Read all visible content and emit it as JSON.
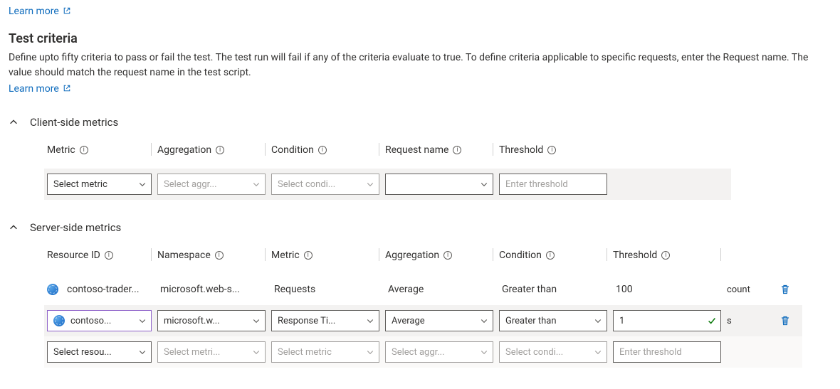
{
  "top_link": "Learn more",
  "section": {
    "title": "Test criteria",
    "description": "Define upto fifty criteria to pass or fail the test. The test run will fail if any of the criteria evaluate to true. To define criteria applicable to specific requests, enter the Request name. The value should match the request name in the test script.",
    "learn_more": "Learn more"
  },
  "client": {
    "title": "Client-side metrics",
    "headers": {
      "metric": "Metric",
      "aggregation": "Aggregation",
      "condition": "Condition",
      "request_name": "Request name",
      "threshold": "Threshold"
    },
    "row": {
      "metric_placeholder": "Select metric",
      "aggregation_placeholder": "Select aggr...",
      "condition_placeholder": "Select condi...",
      "request_value": "",
      "threshold_placeholder": "Enter threshold"
    }
  },
  "server": {
    "title": "Server-side metrics",
    "headers": {
      "resource_id": "Resource ID",
      "namespace": "Namespace",
      "metric": "Metric",
      "aggregation": "Aggregation",
      "condition": "Condition",
      "threshold": "Threshold"
    },
    "rows": [
      {
        "kind": "static",
        "resource_id": "contoso-trader...",
        "namespace": "microsoft.web-s...",
        "metric": "Requests",
        "aggregation": "Average",
        "condition": "Greater than",
        "threshold": "100",
        "unit": "count"
      },
      {
        "kind": "editable",
        "resource_id": "contoso...",
        "namespace": "microsoft.w...",
        "metric": "Response Ti...",
        "aggregation": "Average",
        "condition": "Greater than",
        "threshold": "1",
        "unit": "s"
      },
      {
        "kind": "placeholder",
        "resource_id": "Select resou...",
        "namespace": "Select metri...",
        "metric": "Select metric",
        "aggregation": "Select aggr...",
        "condition": "Select condi...",
        "threshold_placeholder": "Enter threshold"
      }
    ]
  }
}
